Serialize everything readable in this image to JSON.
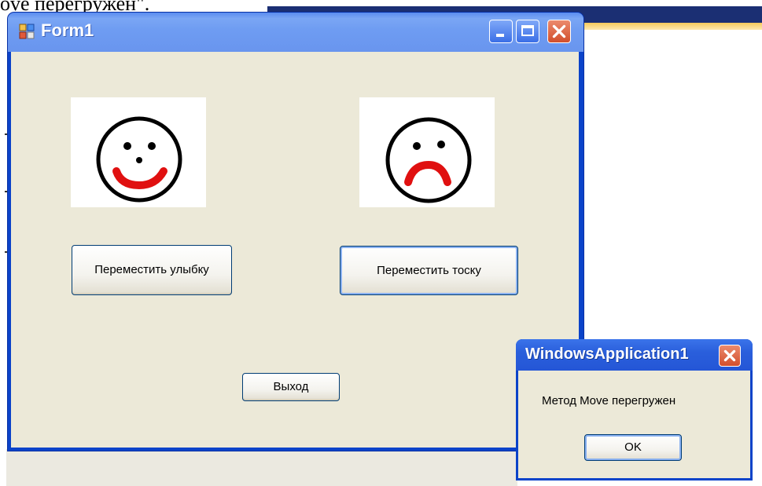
{
  "background": {
    "doc_text": "ove перегружен\".",
    "colors": {
      "ide_dark": "#1b2f73",
      "ide_accent": "#f5c95a"
    }
  },
  "form": {
    "title": "Form1",
    "icon": "form-app-icon",
    "controls": {
      "minimize": "minimize-icon",
      "maximize": "maximize-icon",
      "close": "close-icon"
    },
    "smile_picture": "smiley-face-icon",
    "sad_picture": "sad-face-icon",
    "move_smile_button": "Переместить улыбку",
    "move_sad_button": "Переместить тоску",
    "exit_button": "Выход",
    "colors": {
      "titlebar": "#6995ee",
      "client": "#ece9d8",
      "frame": "#0b43c9",
      "mouth": "#e01010"
    }
  },
  "message_box": {
    "title": "WindowsApplication1",
    "message": "Метод Move перегружен",
    "ok_button": "OK",
    "close_icon": "close-icon"
  }
}
